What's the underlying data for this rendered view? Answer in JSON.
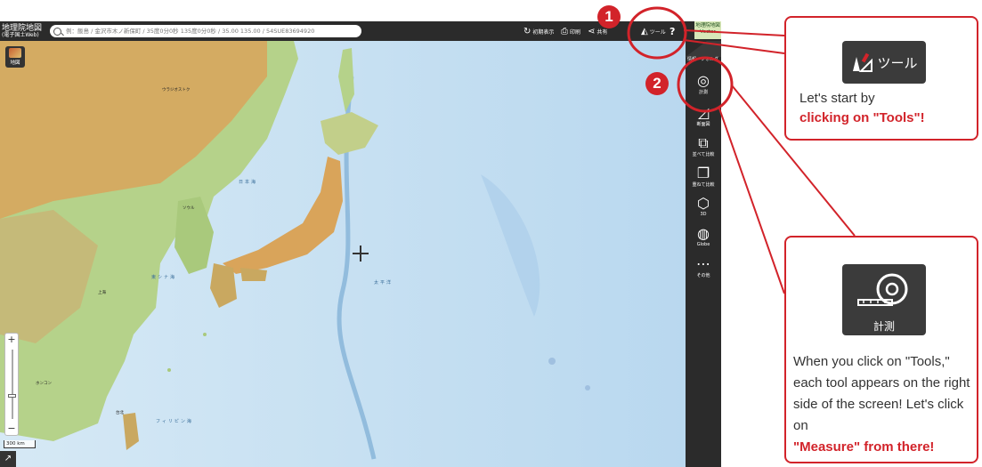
{
  "topbar": {
    "title": "地理院地図",
    "subtitle": "(電子国土Web)",
    "search_placeholder": "例：飯島 / 金沢市木ノ新保町 / 35度0分0秒 135度0分0秒 / 35.00 135.00 / 54SUE83694920",
    "init_label": "初期表示",
    "print_label": "印刷",
    "share_label": "共有",
    "tool_label": "ツール",
    "help_label": "?"
  },
  "brand": {
    "text": "地理院地図 Vector"
  },
  "map": {
    "map_button_label": "地図",
    "scale_label": "300 km",
    "zoom_in": "+",
    "zoom_out": "−",
    "corner_icon": "↗",
    "sea_labels": [
      "日本海",
      "東シナ海",
      "太平洋",
      "フィリピン海"
    ],
    "city_labels": [
      "ウラジオストク",
      "ソウル",
      "上海",
      "台北",
      "ホンコン"
    ],
    "colors": {
      "sea": "#cfe4f3",
      "land_low": "#a9cf82",
      "land_high": "#d9a45a"
    }
  },
  "sidebar": {
    "top_label": "情報・フォルダ",
    "items": [
      {
        "label": "計測",
        "icon": "measure-icon"
      },
      {
        "label": "断面図",
        "icon": "cross-section-icon"
      },
      {
        "label": "並べて比較",
        "icon": "side-by-side-icon"
      },
      {
        "label": "重ねて比較",
        "icon": "overlay-icon"
      },
      {
        "label": "3D",
        "icon": "cube-icon"
      },
      {
        "label": "Globe",
        "icon": "globe-icon"
      },
      {
        "label": "その他",
        "icon": "more-icon"
      }
    ]
  },
  "annotations": {
    "badge1": "1",
    "badge2": "2",
    "callout1": {
      "card_label": "ツール",
      "line1": "Let's start by",
      "line2": "clicking on \"Tools\"!"
    },
    "callout2": {
      "card_label": "計測",
      "text": "When you click on \"Tools,\" each tool appears on the right side of the screen! Let's click on",
      "emphasis": "\"Measure\" from there!"
    },
    "accent_color": "#d2232a"
  }
}
